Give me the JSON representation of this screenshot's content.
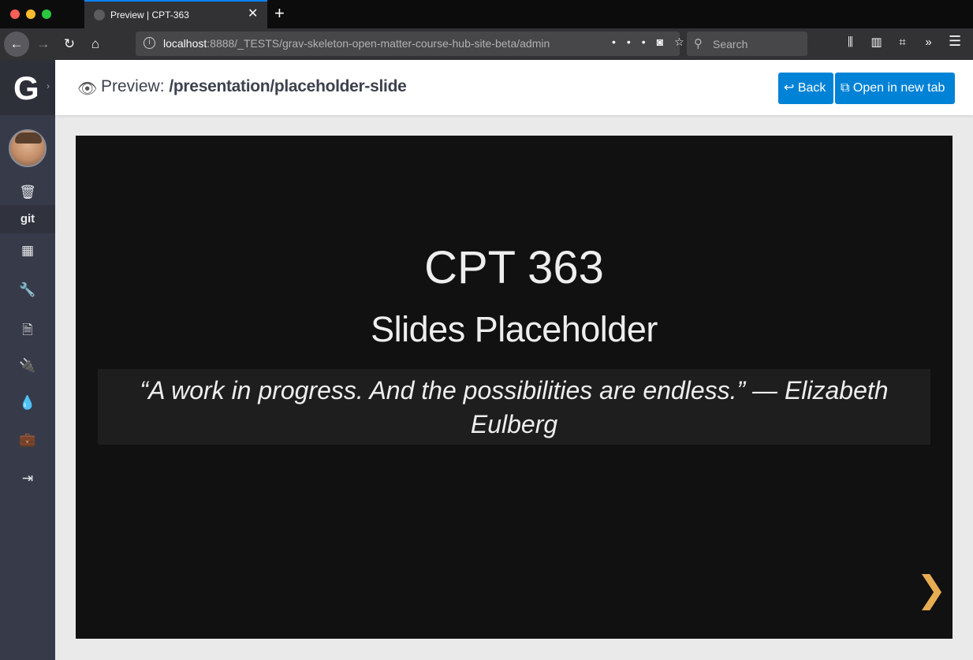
{
  "browser": {
    "tab_title": "Preview | CPT-363",
    "url_host": "localhost",
    "url_path": ":8888/_TESTS/grav-skeleton-open-matter-course-hub-site-beta/admin",
    "search_placeholder": "Search"
  },
  "sidebar": {
    "git_label": "git",
    "icons": [
      "trash-icon",
      "git-icon",
      "dashboard-icon",
      "configuration-icon",
      "pages-icon",
      "plugins-icon",
      "themes-icon",
      "tools-icon",
      "logout-icon"
    ]
  },
  "header": {
    "preview_prefix": "Preview:",
    "preview_path": "/presentation/placeholder-slide",
    "back_label": "Back",
    "open_new_tab_label": "Open in new tab"
  },
  "slide": {
    "title": "CPT 363",
    "subtitle": "Slides Placeholder",
    "quote": "“A work in progress. And the possibilities are endless.” — Elizabeth Eulberg"
  },
  "colors": {
    "accent": "#0082d6",
    "sidebar": "#373b49",
    "slide_bg": "#111111",
    "nav_arrow": "#e7ad52"
  }
}
